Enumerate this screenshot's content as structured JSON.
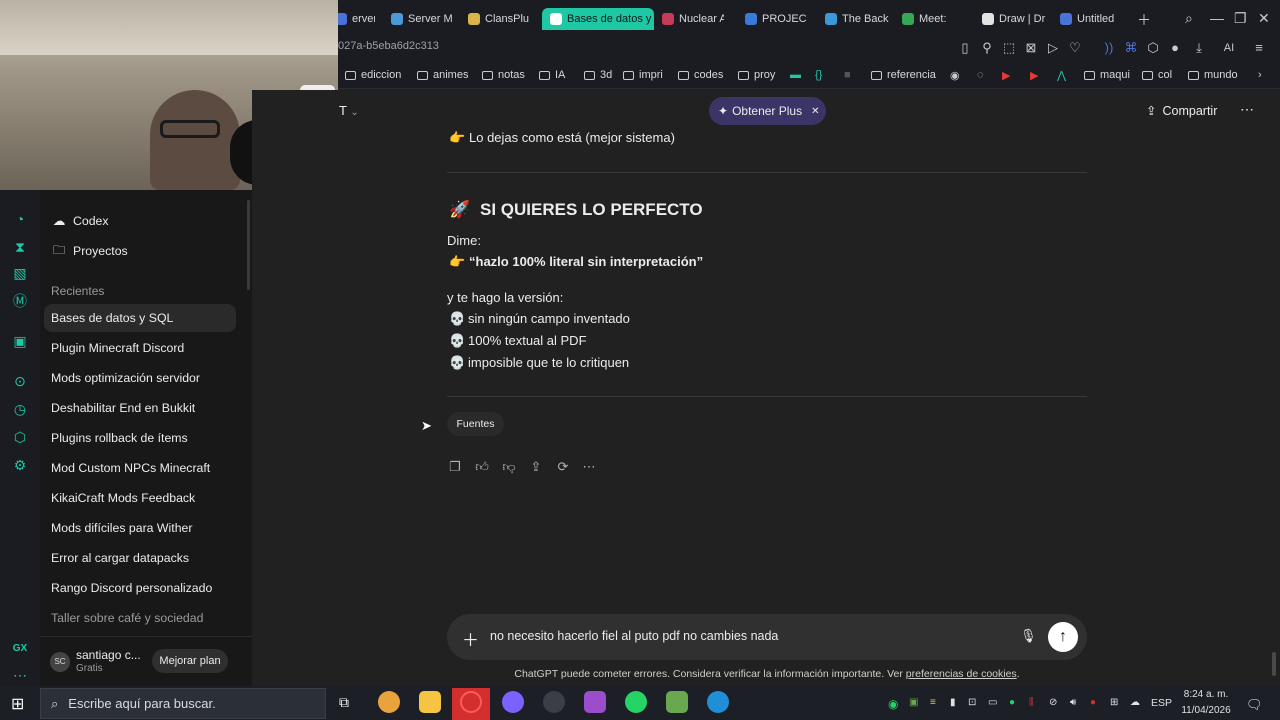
{
  "browser": {
    "tabs": [
      {
        "label": "erver M",
        "color": "#4a72d8"
      },
      {
        "label": "Server M",
        "color": "#4a9ad8"
      },
      {
        "label": "ClansPlu",
        "color": "#d8b54a"
      },
      {
        "label": "Bases de datos y",
        "color": "#ffffff",
        "active": true
      },
      {
        "label": "Nuclear A",
        "color": "#c83a5a"
      },
      {
        "label": "PROJECT",
        "color": "#3a7ad8"
      },
      {
        "label": "The Back",
        "color": "#3a9ad8"
      },
      {
        "label": "Meet:",
        "color": "#34a853"
      },
      {
        "label": "Draw | Dr",
        "color": "#e3e3e3"
      },
      {
        "label": "Untitled",
        "color": "#4a72d8"
      }
    ],
    "url_fragment": "027a-b5eba6d2c313",
    "toolbar_ai_label": "AI",
    "bookmarks": [
      "ediccion",
      "animes",
      "notas",
      "IA",
      "3d",
      "impri",
      "codes",
      "proy",
      "referencia",
      "maqui",
      "col",
      "mundo"
    ]
  },
  "sidebar": {
    "items_top": [
      {
        "label": "Codex",
        "icon": "codex-icon"
      },
      {
        "label": "Proyectos",
        "icon": "folder-icon"
      }
    ],
    "recent_heading": "Recientes",
    "recents": [
      "Bases de datos y SQL",
      "Plugin Minecraft Discord",
      "Mods optimización servidor",
      "Deshabilitar End en Bukkit",
      "Plugins rollback de ítems",
      "Mod Custom NPCs Minecraft",
      "KikaiCraft Mods Feedback",
      "Mods difíciles para Wither",
      "Error al cargar datapacks",
      "Rango Discord personalizado",
      "Taller sobre café y sociedad"
    ],
    "user": {
      "initials": "SC",
      "name": "santiago c...",
      "plan": "Gratis",
      "upgrade_label": "Mejorar plan"
    }
  },
  "header": {
    "model_fragment": "T",
    "plus_label": "Obtener Plus",
    "share_label": "Compartir"
  },
  "message": {
    "line_top": "Lo dejas como está (mejor sistema)",
    "heading": "SI QUIERES LO PERFECTO",
    "dime": "Dime:",
    "quote": "“hazlo 100% literal sin interpretación”",
    "intro": "y te hago la versión:",
    "bullets": [
      "sin ningún campo inventado",
      "100% textual al PDF",
      "imposible que te lo critiquen"
    ],
    "sources_label": "Fuentes"
  },
  "composer": {
    "value": "no necesito hacerlo fiel al puto pdf no cambies nada",
    "disclaimer": "ChatGPT puede cometer errores. Considera verificar la información importante. Ver",
    "disclaimer_link": "preferencias de cookies",
    "disclaimer_end": "."
  },
  "taskbar": {
    "search_placeholder": "Escribe aquí para buscar.",
    "lang": "ESP",
    "time": "8:24 a. m.",
    "date": "11/04/2026"
  },
  "colors": {
    "accent": "#1ec8a5",
    "plus_bg": "#3a3566",
    "send": "#ffffff"
  }
}
